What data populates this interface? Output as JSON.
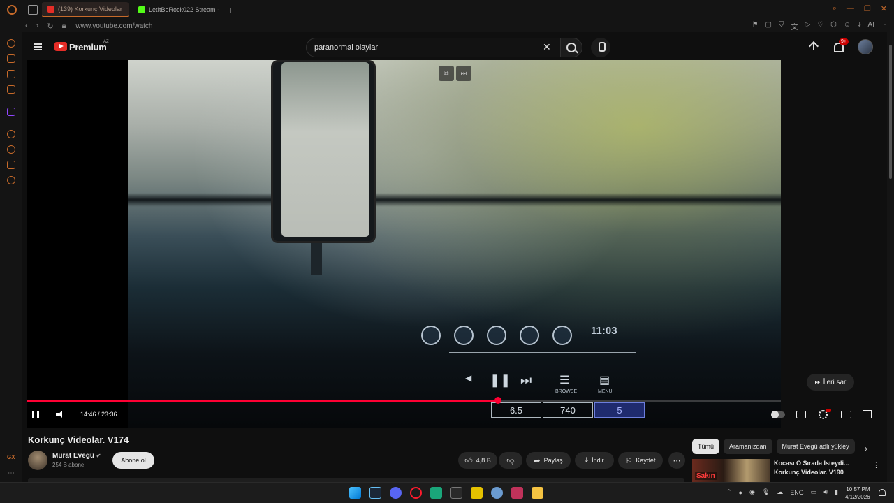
{
  "browser": {
    "tabs": [
      {
        "label": "(139) Korkunç Videolar",
        "active": true,
        "favicon": "youtube-icon"
      },
      {
        "label": "LetItBeRock022 Stream - ",
        "active": false,
        "favicon": "kick-icon"
      }
    ],
    "url": "www.youtube.com/watch",
    "ai_label": "AI"
  },
  "youtube": {
    "brand": "Premium",
    "region": "AZ",
    "search_query": "paranormal olaylar",
    "notifications": "9+"
  },
  "player": {
    "current_time": "14:46",
    "duration": "23:36",
    "time_display": "14:46 / 23:36",
    "progress_fraction": 0.6247,
    "skip_label": "İleri sar",
    "hud": {
      "time": "11:03",
      "browse": "BROWSE",
      "menu": "MENU",
      "box_values": [
        "6.5",
        "740",
        "5"
      ]
    }
  },
  "video": {
    "title": "Korkunç Videolar. V174",
    "channel": "Murat Evegü",
    "subscribers": "254 B abone",
    "subscribe_label": "Abone ol",
    "likes": "4,8 B",
    "share_label": "Paylaş",
    "download_label": "İndir",
    "save_label": "Kaydet"
  },
  "recommendations": {
    "chips": [
      "Tümü",
      "Aramanızdan",
      "Murat Evegü adlı yükley"
    ],
    "items": [
      {
        "title": "Kocası O Sırada İsteydi... Korkunç Videolar. V190",
        "thumb_tag": "Sakın"
      }
    ]
  },
  "taskbar": {
    "language": "ENG",
    "time": "10:57 PM",
    "date": "4/12/2026"
  },
  "colors": {
    "accent": "#c76a2a",
    "progress": "#ff0033",
    "youtube_red": "#e52d27"
  }
}
